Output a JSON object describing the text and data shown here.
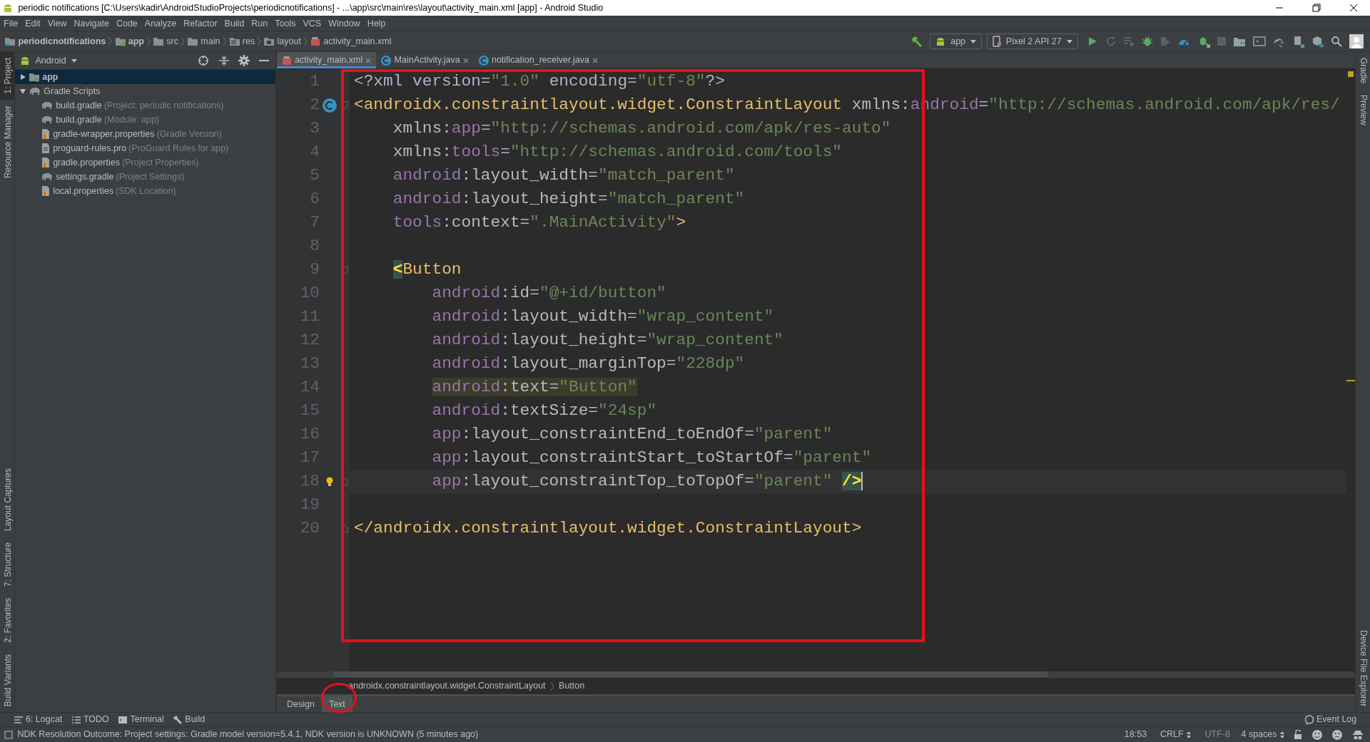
{
  "window": {
    "title": "periodic notifications [C:\\Users\\kadir\\AndroidStudioProjects\\periodicnotifications] - ...\\app\\src\\main\\res\\layout\\activity_main.xml [app] - Android Studio"
  },
  "menu": [
    "File",
    "Edit",
    "View",
    "Navigate",
    "Code",
    "Analyze",
    "Refactor",
    "Build",
    "Run",
    "Tools",
    "VCS",
    "Window",
    "Help"
  ],
  "breadcrumb": [
    {
      "label": "periodicnotifications",
      "kind": "project"
    },
    {
      "label": "app",
      "kind": "module"
    },
    {
      "label": "src",
      "kind": "folder"
    },
    {
      "label": "main",
      "kind": "folder"
    },
    {
      "label": "res",
      "kind": "res"
    },
    {
      "label": "layout",
      "kind": "layout"
    },
    {
      "label": "activity_main.xml",
      "kind": "xml"
    }
  ],
  "toolbar": {
    "run_config": "app",
    "device": "Pixel 2 API 27"
  },
  "left_tool_tabs_top": [
    {
      "label": "1: Project",
      "selected": true
    },
    {
      "label": "Resource Manager",
      "selected": false
    }
  ],
  "left_tool_tabs_bottom": [
    {
      "label": "Layout Captures",
      "selected": false
    },
    {
      "label": "7: Structure",
      "selected": false
    },
    {
      "label": "2: Favorites",
      "selected": false
    },
    {
      "label": "Build Variants",
      "selected": false
    }
  ],
  "right_tool_tabs_top": [
    {
      "label": "Gradle",
      "selected": false
    },
    {
      "label": "Preview",
      "selected": false
    }
  ],
  "right_tool_tabs_bottom": [
    {
      "label": "Device File Explorer",
      "selected": false
    }
  ],
  "project_panel": {
    "view": "Android",
    "tree": [
      {
        "label": "app",
        "kind": "module",
        "selected": true,
        "expanded": false
      },
      {
        "label": "Gradle Scripts",
        "kind": "gradle",
        "selected": false,
        "expanded": true,
        "children": [
          {
            "label": "build.gradle",
            "hint": "(Project: periodic notifications)",
            "kind": "gradle",
            "selected": false
          },
          {
            "label": "build.gradle",
            "hint": "(Module: app)",
            "kind": "gradle",
            "selected": false
          },
          {
            "label": "gradle-wrapper.properties",
            "hint": "(Gradle Version)",
            "kind": "properties",
            "selected": false
          },
          {
            "label": "proguard-rules.pro",
            "hint": "(ProGuard Rules for app)",
            "kind": "text",
            "selected": false
          },
          {
            "label": "gradle.properties",
            "hint": "(Project Properties)",
            "kind": "properties",
            "selected": false
          },
          {
            "label": "settings.gradle",
            "hint": "(Project Settings)",
            "kind": "gradle",
            "selected": false
          },
          {
            "label": "local.properties",
            "hint": "(SDK Location)",
            "kind": "properties",
            "selected": false
          }
        ]
      }
    ]
  },
  "editor_tabs": [
    {
      "label": "activity_main.xml",
      "kind": "xml",
      "selected": true
    },
    {
      "label": "MainActivity.java",
      "kind": "java",
      "selected": false
    },
    {
      "label": "notification_receiver.java",
      "kind": "java",
      "selected": false
    }
  ],
  "code": {
    "lines": [
      {
        "number": "1",
        "highlighted": false,
        "current": false,
        "tokens": [
          {
            "kind": "plain",
            "text": "<?xml version"
          },
          {
            "kind": "plain",
            "text": "="
          },
          {
            "kind": "value",
            "text": "\"1.0\""
          },
          {
            "kind": "plain",
            "text": " encoding"
          },
          {
            "kind": "plain",
            "text": "="
          },
          {
            "kind": "value",
            "text": "\"utf-8\""
          },
          {
            "kind": "plain",
            "text": "?>"
          }
        ]
      },
      {
        "number": "2",
        "highlighted": false,
        "current": false,
        "class_icon": true,
        "fold_start": true,
        "tokens": [
          {
            "kind": "tag",
            "text": "<androidx.constraintlayout.widget.ConstraintLayout"
          },
          {
            "kind": "attr",
            "text": " xmlns:"
          },
          {
            "kind": "ns",
            "text": "android"
          },
          {
            "kind": "plain",
            "text": "="
          },
          {
            "kind": "value",
            "text": "\"http://schemas.android.com/apk/res/"
          }
        ]
      },
      {
        "number": "3",
        "highlighted": false,
        "current": false,
        "tokens": [
          {
            "kind": "attr",
            "text": "    xmlns:"
          },
          {
            "kind": "ns",
            "text": "app"
          },
          {
            "kind": "plain",
            "text": "="
          },
          {
            "kind": "value",
            "text": "\"http://schemas.android.com/apk/res-auto\""
          }
        ]
      },
      {
        "number": "4",
        "highlighted": false,
        "current": false,
        "tokens": [
          {
            "kind": "attr",
            "text": "    xmlns:"
          },
          {
            "kind": "ns",
            "text": "tools"
          },
          {
            "kind": "plain",
            "text": "="
          },
          {
            "kind": "value",
            "text": "\"http://schemas.android.com/tools\""
          }
        ]
      },
      {
        "number": "5",
        "highlighted": false,
        "current": false,
        "tokens": [
          {
            "kind": "ns",
            "text": "    android"
          },
          {
            "kind": "attr",
            "text": ":layout_width"
          },
          {
            "kind": "plain",
            "text": "="
          },
          {
            "kind": "value",
            "text": "\"match_parent\""
          }
        ]
      },
      {
        "number": "6",
        "highlighted": false,
        "current": false,
        "tokens": [
          {
            "kind": "ns",
            "text": "    android"
          },
          {
            "kind": "attr",
            "text": ":layout_height"
          },
          {
            "kind": "plain",
            "text": "="
          },
          {
            "kind": "value",
            "text": "\"match_parent\""
          }
        ]
      },
      {
        "number": "7",
        "highlighted": false,
        "current": false,
        "tokens": [
          {
            "kind": "ns",
            "text": "    tools"
          },
          {
            "kind": "attr",
            "text": ":context"
          },
          {
            "kind": "plain",
            "text": "="
          },
          {
            "kind": "value",
            "text": "\".MainActivity\""
          },
          {
            "kind": "tag",
            "text": ">"
          }
        ]
      },
      {
        "number": "8",
        "highlighted": false,
        "current": false
      },
      {
        "number": "9",
        "highlighted": false,
        "current": false,
        "fold_start": true,
        "tokens": [
          {
            "kind": "match",
            "text": "    <"
          },
          {
            "kind": "tag",
            "text": "Button"
          }
        ]
      },
      {
        "number": "10",
        "highlighted": false,
        "current": false,
        "tokens": [
          {
            "kind": "ns",
            "text": "        android"
          },
          {
            "kind": "attr",
            "text": ":id"
          },
          {
            "kind": "plain",
            "text": "="
          },
          {
            "kind": "value",
            "text": "\"@+id/button\""
          }
        ]
      },
      {
        "number": "11",
        "highlighted": false,
        "current": false,
        "tokens": [
          {
            "kind": "ns",
            "text": "        android"
          },
          {
            "kind": "attr",
            "text": ":layout_width"
          },
          {
            "kind": "plain",
            "text": "="
          },
          {
            "kind": "value",
            "text": "\"wrap_content\""
          }
        ]
      },
      {
        "number": "12",
        "highlighted": false,
        "current": false,
        "tokens": [
          {
            "kind": "ns",
            "text": "        android"
          },
          {
            "kind": "attr",
            "text": ":layout_height"
          },
          {
            "kind": "plain",
            "text": "="
          },
          {
            "kind": "value",
            "text": "\"wrap_content\""
          }
        ]
      },
      {
        "number": "13",
        "highlighted": false,
        "current": false,
        "tokens": [
          {
            "kind": "ns",
            "text": "        android"
          },
          {
            "kind": "attr",
            "text": ":layout_marginTop"
          },
          {
            "kind": "plain",
            "text": "="
          },
          {
            "kind": "value",
            "text": "\"228dp\""
          }
        ]
      },
      {
        "number": "14",
        "highlighted": true,
        "current": false,
        "tokens": [
          {
            "kind": "ns",
            "text": "        android"
          },
          {
            "kind": "attr",
            "text": ":text"
          },
          {
            "kind": "plain",
            "text": "="
          },
          {
            "kind": "value",
            "text": "\"Button\""
          }
        ]
      },
      {
        "number": "15",
        "highlighted": false,
        "current": false,
        "tokens": [
          {
            "kind": "ns",
            "text": "        android"
          },
          {
            "kind": "attr",
            "text": ":textSize"
          },
          {
            "kind": "plain",
            "text": "="
          },
          {
            "kind": "value",
            "text": "\"24sp\""
          }
        ]
      },
      {
        "number": "16",
        "highlighted": false,
        "current": false,
        "tokens": [
          {
            "kind": "ns",
            "text": "        app"
          },
          {
            "kind": "attr",
            "text": ":layout_constraintEnd_toEndOf"
          },
          {
            "kind": "plain",
            "text": "="
          },
          {
            "kind": "value",
            "text": "\"parent\""
          }
        ]
      },
      {
        "number": "17",
        "highlighted": false,
        "current": false,
        "tokens": [
          {
            "kind": "ns",
            "text": "        app"
          },
          {
            "kind": "attr",
            "text": ":layout_constraintStart_toStartOf"
          },
          {
            "kind": "plain",
            "text": "="
          },
          {
            "kind": "value",
            "text": "\"parent\""
          }
        ]
      },
      {
        "number": "18",
        "highlighted": false,
        "current": true,
        "intention_bulb": true,
        "fold_end": true,
        "tokens": [
          {
            "kind": "ns",
            "text": "        app"
          },
          {
            "kind": "attr",
            "text": ":layout_constraintTop_toTopOf"
          },
          {
            "kind": "plain",
            "text": "="
          },
          {
            "kind": "value",
            "text": "\"parent\""
          },
          {
            "kind": "match",
            "text": " />"
          }
        ]
      },
      {
        "number": "19",
        "highlighted": false,
        "current": false
      },
      {
        "number": "20",
        "highlighted": false,
        "current": false,
        "fold_end": true,
        "tokens": [
          {
            "kind": "tag",
            "text": "</androidx.constraintlayout.widget.ConstraintLayout>"
          }
        ]
      }
    ]
  },
  "editor_breadcrumb": [
    "androidx.constraintlayout.widget.ConstraintLayout",
    "Button"
  ],
  "view_tabs": [
    {
      "label": "Design",
      "selected": false
    },
    {
      "label": "Text",
      "selected": true
    }
  ],
  "bottom_tool_tabs": [
    {
      "label": "6: Logcat",
      "kind": "logcat"
    },
    {
      "label": "TODO",
      "kind": "todo"
    },
    {
      "label": "Terminal",
      "kind": "terminal"
    },
    {
      "label": "Build",
      "kind": "build"
    }
  ],
  "event_log": "Event Log",
  "status_bar": {
    "message": "NDK Resolution Outcome: Project settings: Gradle model version=5.4.1, NDK version is UNKNOWN (5 minutes ago)",
    "position": "18:53",
    "line_separator": "CRLF",
    "encoding": "UTF-8",
    "indent": "4 spaces"
  }
}
